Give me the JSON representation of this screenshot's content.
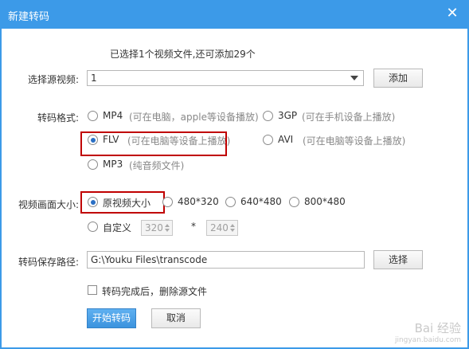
{
  "window": {
    "title": "新建转码",
    "close_symbol": "✕"
  },
  "info_text": "已选择1个视频文件,还可添加29个",
  "source_video": {
    "label": "选择源视频:",
    "selected": "1",
    "add_button": "添加"
  },
  "format": {
    "label": "转码格式:",
    "options": [
      {
        "name": "MP4",
        "hint": "(可在电脑，apple等设备播放)",
        "checked": false
      },
      {
        "name": "3GP",
        "hint": "(可在手机设备上播放)",
        "checked": false
      },
      {
        "name": "FLV",
        "hint": "(可在电脑等设备上播放)",
        "checked": true
      },
      {
        "name": "AVI",
        "hint": "(可在电脑等设备上播放)",
        "checked": false
      },
      {
        "name": "MP3",
        "hint": "(纯音频文件)",
        "checked": false
      }
    ]
  },
  "resolution": {
    "label": "视频画面大小:",
    "options": [
      {
        "name": "原视频大小",
        "checked": true
      },
      {
        "name": "480*320",
        "checked": false
      },
      {
        "name": "640*480",
        "checked": false
      },
      {
        "name": "800*480",
        "checked": false
      },
      {
        "name": "自定义",
        "checked": false
      }
    ],
    "custom_width": "320",
    "custom_height": "240",
    "separator": "*"
  },
  "save_path": {
    "label": "转码保存路径:",
    "value": "G:\\Youku Files\\transcode",
    "choose_button": "选择"
  },
  "delete_source": {
    "label": "转码完成后，删除源文件",
    "checked": false
  },
  "actions": {
    "start": "开始转码",
    "cancel": "取消"
  },
  "watermark": {
    "text": "Bai 经验",
    "sub": "jingyan.baidu.com"
  },
  "colors": {
    "titlebar": "#3c9ae8",
    "highlight": "#c00000",
    "primary": "#3b93de"
  }
}
